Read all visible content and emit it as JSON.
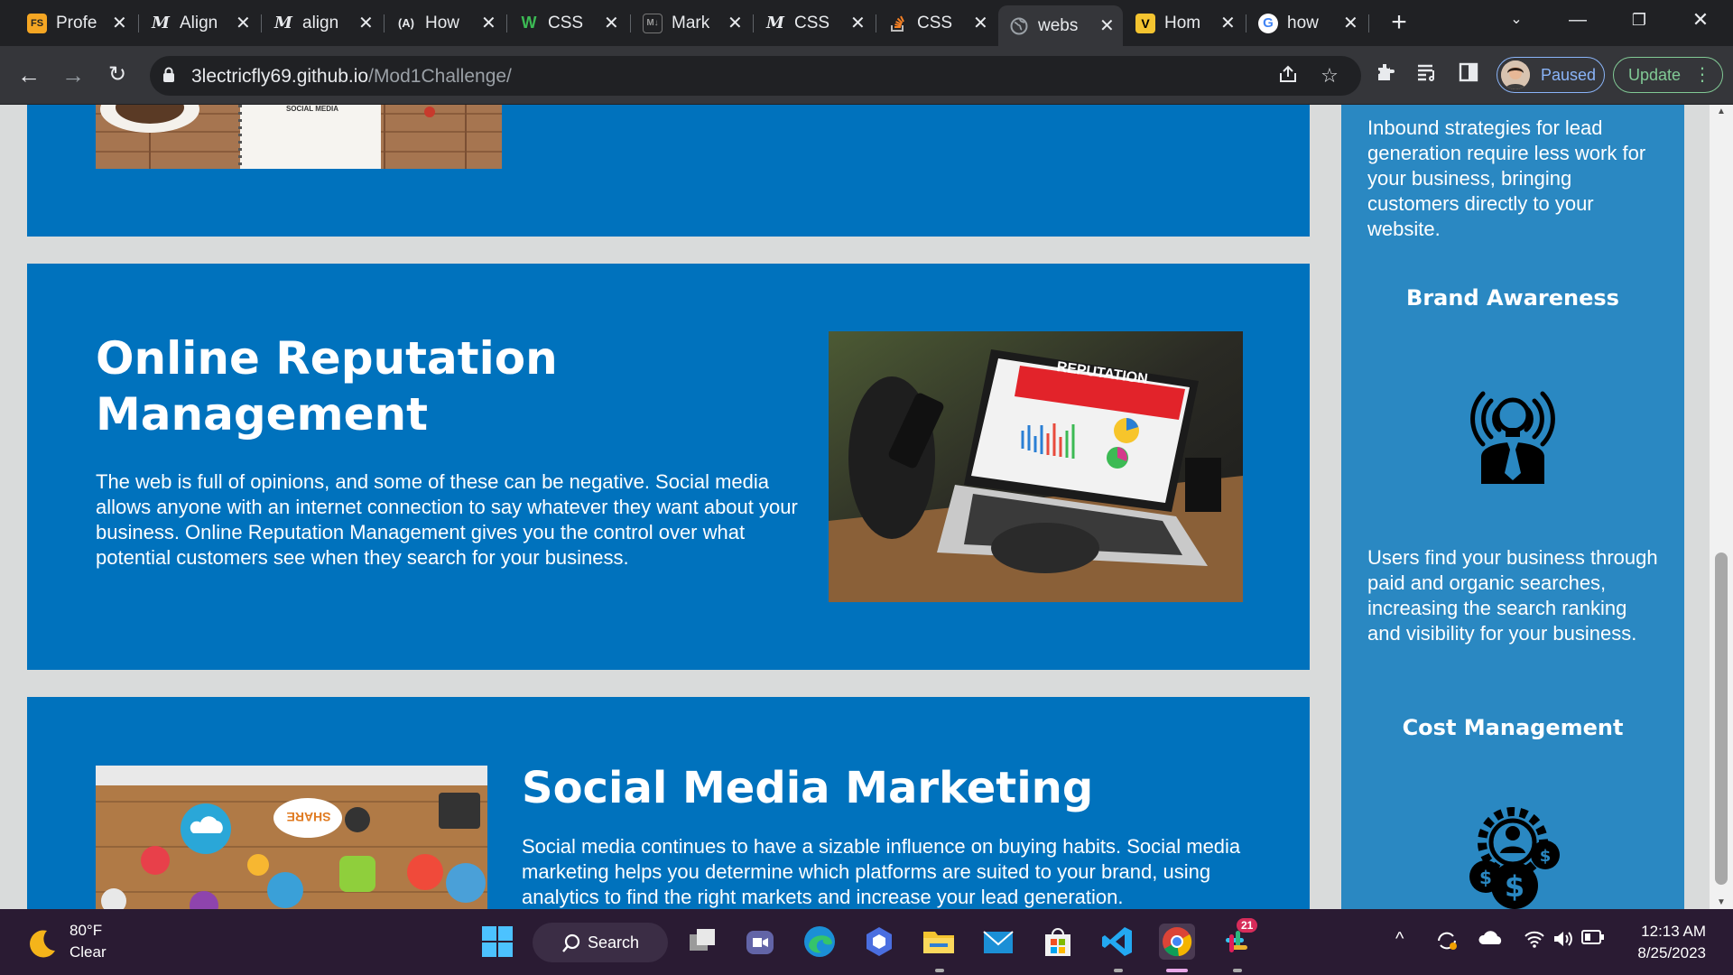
{
  "tabs": [
    {
      "title": "Profe",
      "favicon": "FS",
      "favicon_bg": "#f0a000"
    },
    {
      "title": "Align",
      "favicon": "M",
      "favicon_bg": "#202124"
    },
    {
      "title": "align",
      "favicon": "M",
      "favicon_bg": "#202124"
    },
    {
      "title": "How",
      "favicon": "(A)",
      "favicon_bg": "#202124"
    },
    {
      "title": "CSS",
      "favicon": "W",
      "favicon_bg": "#202124"
    },
    {
      "title": "Mark",
      "favicon": "M↓",
      "favicon_bg": "#444"
    },
    {
      "title": "CSS",
      "favicon": "M",
      "favicon_bg": "#202124"
    },
    {
      "title": "CSS",
      "favicon": "SO",
      "favicon_bg": "#202124"
    },
    {
      "title": "webs",
      "favicon": "globe",
      "favicon_bg": "#35363a"
    },
    {
      "title": "Hom",
      "favicon": "V",
      "favicon_bg": "#202124"
    },
    {
      "title": "how",
      "favicon": "G",
      "favicon_bg": "#fff"
    }
  ],
  "toolbar": {
    "url_host": "3lectricfly69.github.io",
    "url_path": "/Mod1Challenge/",
    "profile_label": "Paused",
    "update_label": "Update"
  },
  "page": {
    "top_image_caption": "SOCIAL MEDIA",
    "reputation": {
      "title": "Online Reputation Management",
      "body": "The web is full of opinions, and some of these can be negative. Social media allows anyone with an internet connection to say whatever they want about your business. Online Reputation Management gives you the control over what potential customers see when they search for your business.",
      "image_label": "REPUTATION"
    },
    "social": {
      "title": "Social Media Marketing",
      "body": "Social media continues to have a sizable influence on buying habits. Social media marketing helps you determine which platforms are suited to your brand, using analytics to find the right markets and increase your lead generation.",
      "image_label": "SHARE"
    },
    "sidebar": {
      "lead_text": "Inbound strategies for lead generation require less work for your business, bringing customers directly to your website.",
      "brand_title": "Brand Awareness",
      "brand_text": "Users find your business through paid and organic searches, increasing the search ranking and visibility for your business.",
      "cost_title": "Cost Management"
    }
  },
  "taskbar": {
    "temperature": "80°F",
    "condition": "Clear",
    "search_label": "Search",
    "time": "12:13 AM",
    "date": "8/25/2023",
    "slack_badge": "21"
  },
  "colors": {
    "card_blue": "#0072bd",
    "sidebar_blue": "#2a88c2",
    "page_gray": "#d9dbdb"
  }
}
